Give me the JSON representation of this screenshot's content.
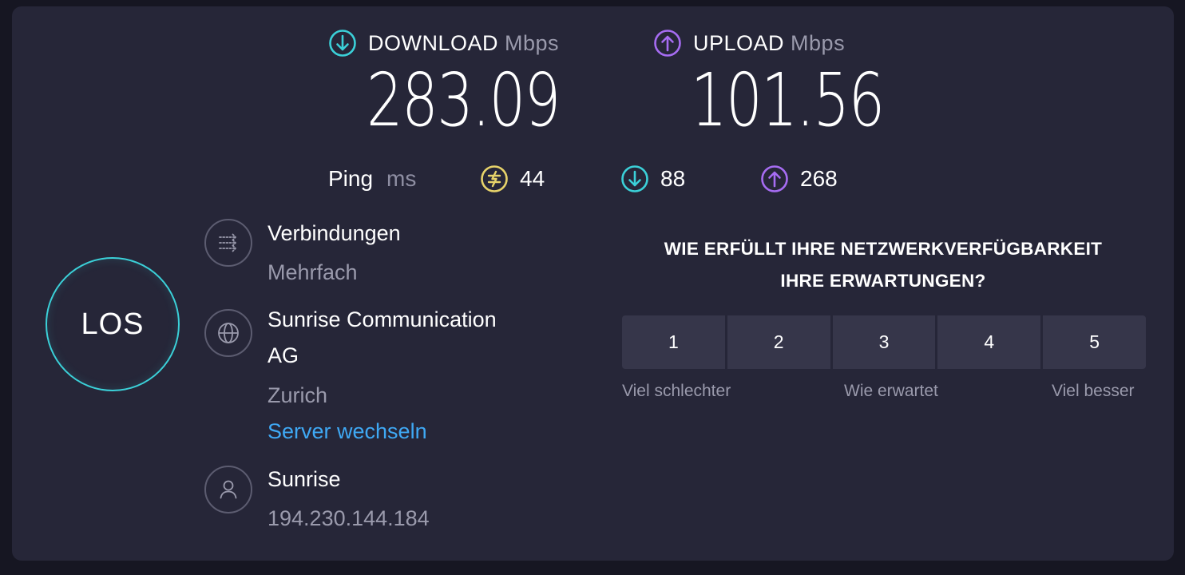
{
  "download": {
    "label": "DOWNLOAD",
    "unit": "Mbps",
    "value": "283.09",
    "icon": "arrow-down-circle-icon",
    "color": "#3bd0d8"
  },
  "upload": {
    "label": "UPLOAD",
    "unit": "Mbps",
    "value": "101.56",
    "icon": "arrow-up-circle-icon",
    "color": "#a66cf2"
  },
  "ping": {
    "label": "Ping",
    "unit": "ms",
    "idle": {
      "value": "44",
      "icon": "jitter-icon",
      "color": "#e7d36a"
    },
    "download": {
      "value": "88",
      "icon": "arrow-down-circle-icon",
      "color": "#3bd0d8"
    },
    "upload": {
      "value": "268",
      "icon": "arrow-up-circle-icon",
      "color": "#a66cf2"
    }
  },
  "go_button": {
    "label": "LOS"
  },
  "connections": {
    "title": "Verbindungen",
    "value": "Mehrfach",
    "icon": "connections-icon"
  },
  "server": {
    "title_line1": "Sunrise Communication",
    "title_line2": "AG",
    "location": "Zurich",
    "change_link": "Server wechseln",
    "icon": "globe-icon"
  },
  "provider": {
    "name": "Sunrise",
    "ip": "194.230.144.184",
    "icon": "user-icon"
  },
  "survey": {
    "question_line1": "WIE ERFÜLLT IHRE NETZWERKVERFÜGBARKEIT",
    "question_line2": "IHRE ERWARTUNGEN?",
    "options": [
      "1",
      "2",
      "3",
      "4",
      "5"
    ],
    "label_low": "Viel schlechter",
    "label_mid": "Wie erwartet",
    "label_high": "Viel besser"
  }
}
